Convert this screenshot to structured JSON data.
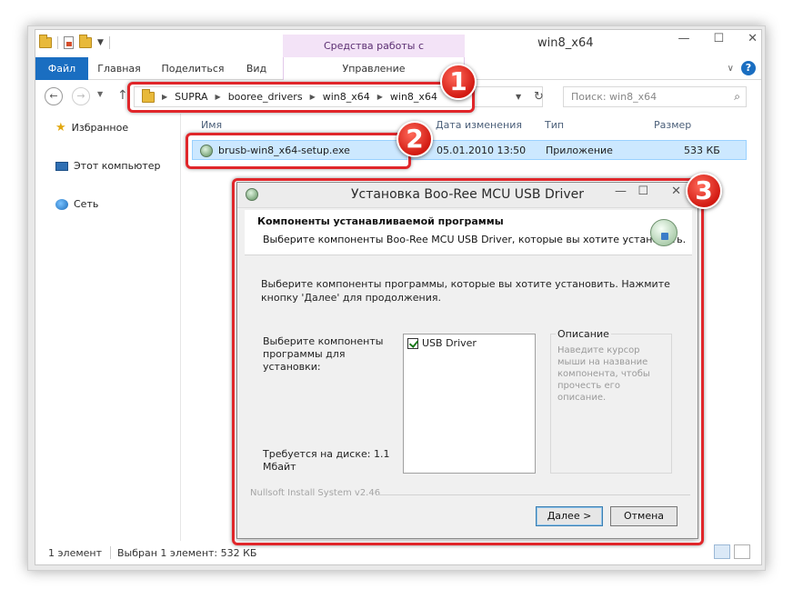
{
  "window": {
    "title": "win8_x64",
    "context_tab_group": "Средства работы с приложениями",
    "controls": {
      "minimize": "—",
      "maximize": "☐",
      "close": "✕"
    }
  },
  "ribbon": {
    "tabs": [
      "Файл",
      "Главная",
      "Поделиться",
      "Вид",
      "Управление"
    ],
    "help": "?",
    "collapse": "∨"
  },
  "address": {
    "crumbs": [
      "SUPRA",
      "booree_drivers",
      "win8_x64",
      "win8_x64"
    ],
    "search_placeholder": "Поиск: win8_x64"
  },
  "sidebar": {
    "items": [
      "Избранное",
      "Этот компьютер",
      "Сеть"
    ]
  },
  "file_list": {
    "columns": [
      "Имя",
      "Дата изменения",
      "Тип",
      "Размер"
    ],
    "rows": [
      {
        "name": "brusb-win8_x64-setup.exe",
        "date": "05.01.2010 13:50",
        "type": "Приложение",
        "size": "533 КБ"
      }
    ]
  },
  "status": {
    "count": "1 элемент",
    "selected": "Выбран 1 элемент: 532 КБ"
  },
  "installer": {
    "title": "Установка Boo-Ree MCU USB Driver",
    "header_title": "Компоненты устанавливаемой программы",
    "header_subtitle": "Выберите компоненты Boo-Ree MCU USB Driver, которые вы хотите установить.",
    "body_text": "Выберите компоненты программы, которые вы хотите установить. Нажмите кнопку 'Далее' для продолжения.",
    "components_label": "Выберите компоненты программы для установки:",
    "components": [
      {
        "label": "USB Driver",
        "checked": true
      }
    ],
    "description_title": "Описание",
    "description_text": "Наведите курсор мыши на название компонента, чтобы прочесть его описание.",
    "disk_space": "Требуется на диске: 1.1 Мбайт",
    "branding": "Nullsoft Install System v2.46",
    "next_label": "Далее >",
    "cancel_label": "Отмена"
  },
  "annotations": {
    "badges": [
      "1",
      "2",
      "3"
    ],
    "color": "#e0262a"
  }
}
